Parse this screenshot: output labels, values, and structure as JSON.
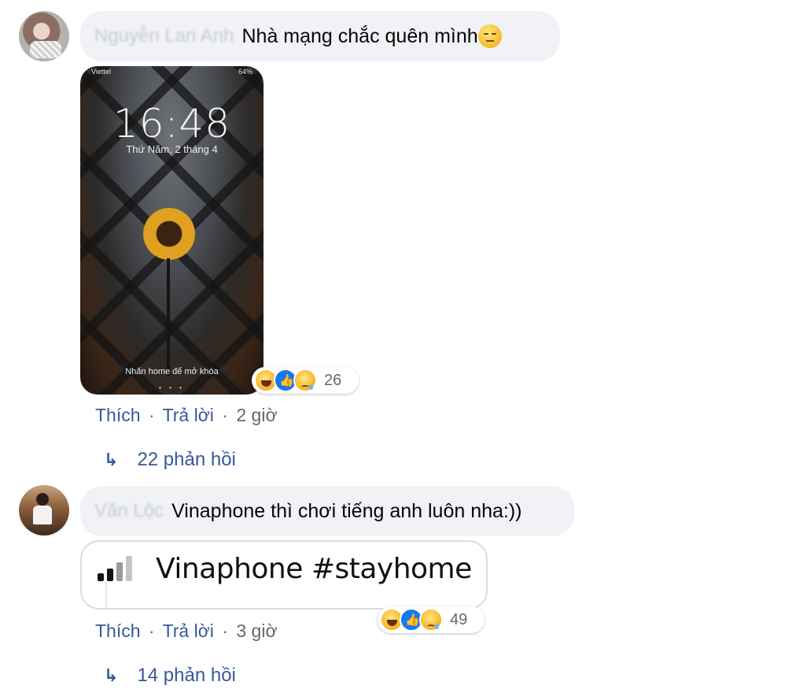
{
  "comments": [
    {
      "author_blurred": "Nguyễn Lan Anh",
      "text": "Nhà mạng chắc quên mình",
      "emoji": "unamused-face-icon",
      "attachment": {
        "status_carrier": "Viettel",
        "status_battery": "64%",
        "time": "16:48",
        "date": "Thứ Năm, 2 tháng 4",
        "unlock_hint": "Nhấn home để mở khóa"
      },
      "reactions": {
        "icons": [
          "haha-icon",
          "like-icon",
          "sad-icon"
        ],
        "count": "26"
      },
      "actions": {
        "like": "Thích",
        "reply": "Trả lời",
        "sep": "·",
        "time": "2 giờ"
      },
      "replies": "22 phản hồi"
    },
    {
      "author_blurred": "Văn Lộc",
      "text": "Vinaphone thì chơi tiếng anh luôn nha:))",
      "attachment": {
        "text": "Vinaphone #stayhome"
      },
      "reactions": {
        "icons": [
          "haha-icon",
          "like-icon",
          "sad-icon"
        ],
        "count": "49"
      },
      "actions": {
        "like": "Thích",
        "reply": "Trả lời",
        "sep": "·",
        "time": "3 giờ"
      },
      "replies": "14 phản hồi"
    }
  ],
  "colors": {
    "bubble": "#f0f2f5",
    "link": "#385898",
    "muted": "#65676b",
    "like_blue": "#1877f2"
  }
}
